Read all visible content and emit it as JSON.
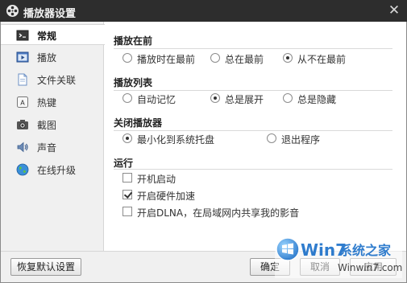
{
  "window": {
    "title": "播放器设置",
    "close_glyph": "✕",
    "app_icon": "film-reel-icon"
  },
  "sidebar": {
    "items": [
      {
        "label": "常规",
        "icon": "terminal-icon",
        "active": true
      },
      {
        "label": "播放",
        "icon": "play-window-icon",
        "active": false
      },
      {
        "label": "文件关联",
        "icon": "file-icon",
        "active": false
      },
      {
        "label": "热键",
        "icon": "key-a-icon",
        "active": false
      },
      {
        "label": "截图",
        "icon": "camera-icon",
        "active": false
      },
      {
        "label": "声音",
        "icon": "speaker-icon",
        "active": false
      },
      {
        "label": "在线升级",
        "icon": "globe-icon",
        "active": false
      }
    ]
  },
  "main": {
    "sections": [
      {
        "title": "播放在前",
        "options": [
          {
            "label": "播放时在最前",
            "checked": false
          },
          {
            "label": "总在最前",
            "checked": false
          },
          {
            "label": "从不在最前",
            "checked": true
          }
        ]
      },
      {
        "title": "播放列表",
        "options": [
          {
            "label": "自动记忆",
            "checked": false
          },
          {
            "label": "总是展开",
            "checked": true
          },
          {
            "label": "总是隐藏",
            "checked": false
          }
        ]
      },
      {
        "title": "关闭播放器",
        "options": [
          {
            "label": "最小化到系统托盘",
            "checked": true
          },
          {
            "label": "退出程序",
            "checked": false
          }
        ]
      },
      {
        "title": "运行",
        "options": [
          {
            "label": "开机启动",
            "checked": false
          },
          {
            "label": "开启硬件加速",
            "checked": true
          },
          {
            "label": "开启DLNA，在局域网内共享我的影音",
            "checked": false
          }
        ]
      }
    ]
  },
  "footer": {
    "restore_label": "恢复默认设置",
    "ok_label": "确定",
    "cancel_label": "取消",
    "apply_label": "应用"
  },
  "watermark": {
    "brand": "系统之家",
    "url": "Winwin7.com",
    "logo_text": "Win7"
  },
  "colors": {
    "titlebar": "#2d2d2d",
    "sidebar_bg": "#f0f0f0",
    "content_bg": "#ffffff",
    "section_line": "#d9d9d9",
    "watermark_blue": "#1a6fc9"
  }
}
